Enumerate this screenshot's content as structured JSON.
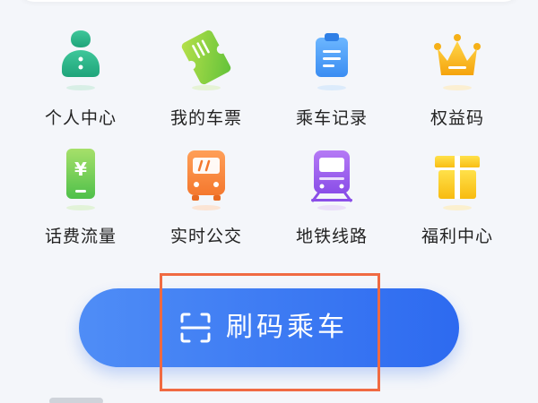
{
  "grid": {
    "items": [
      {
        "label": "个人中心"
      },
      {
        "label": "我的车票"
      },
      {
        "label": "乘车记录"
      },
      {
        "label": "权益码"
      },
      {
        "label": "话费流量"
      },
      {
        "label": "实时公交"
      },
      {
        "label": "地铁线路"
      },
      {
        "label": "福利中心"
      }
    ]
  },
  "ride_button": {
    "label": "刷码乘车"
  },
  "colors": {
    "accent": "#2d6af0",
    "highlight": "#f06a42"
  }
}
